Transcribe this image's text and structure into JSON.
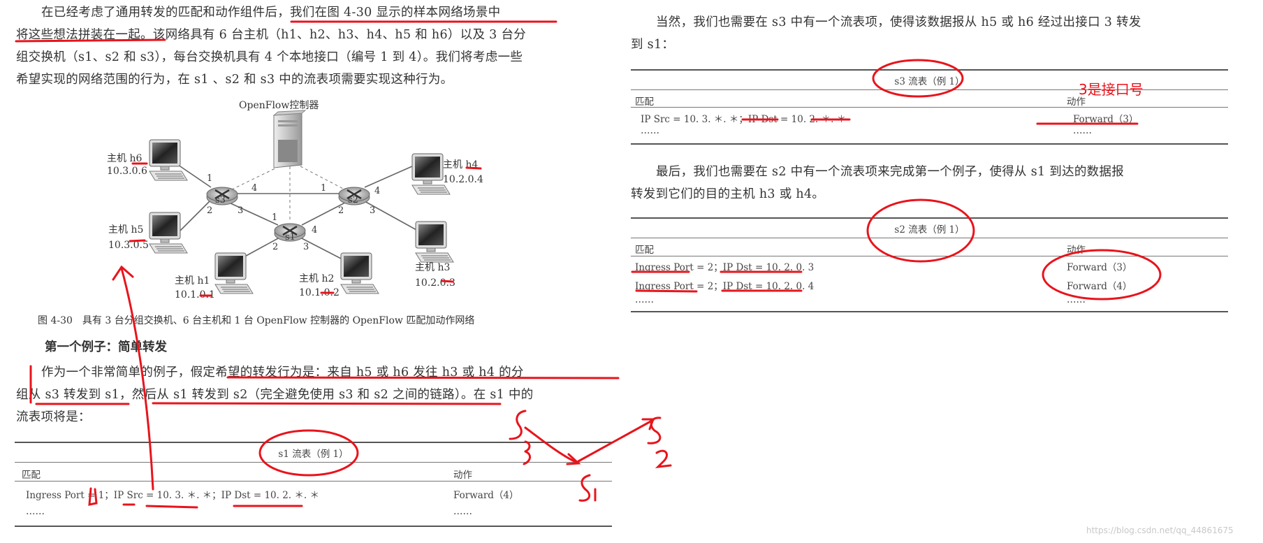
{
  "left": {
    "paragraph1": [
      "在已经考虑了通用转发的匹配和动作组件后，我们在图 4-30 显示的样本网络场景中",
      "将这些想法拼装在一起。该网络具有 6 台主机（h1、h2、h3、h4、h5 和 h6）以及 3 台分",
      "组交换机（s1、s2 和 s3），每台交换机具有 4 个本地接口（编号 1 到 4）。我们将考虑一些",
      "希望实现的网络范围的行为，在 s1 、s2 和 s3 中的流表项需要实现这种行为。"
    ],
    "figure": {
      "controller_label": "OpenFlow控制器",
      "switches": [
        "s1",
        "s2",
        "s3"
      ],
      "hosts": [
        {
          "label": "主机 h1",
          "ip": "10.1.0.1"
        },
        {
          "label": "主机 h2",
          "ip": "10.1.0.2"
        },
        {
          "label": "主机 h3",
          "ip": "10.2.0.3"
        },
        {
          "label": "主机 h4",
          "ip": "10.2.0.4"
        },
        {
          "label": "主机 h5",
          "ip": "10.3.0.5"
        },
        {
          "label": "主机 h6",
          "ip": "10.3.0.6"
        }
      ],
      "ports": {
        "p1": "1",
        "p2": "2",
        "p3": "3",
        "p4": "4"
      },
      "caption": "图 4-30　具有 3 台分组交换机、6 台主机和 1 台 OpenFlow 控制器的 OpenFlow 匹配加动作网络"
    },
    "heading": "第一个例子：简单转发",
    "paragraph2": [
      "作为一个非常简单的例子，假定希望的转发行为是：来自 h5 或 h6 发往 h3 或 h4 的分",
      "组从 s3 转发到 s1，然后从 s1 转发到 s2（完全避免使用 s3 和 s2 之间的链路）。在 s1 中的",
      "流表项将是："
    ],
    "s1_table": {
      "caption": "s1 流表（例 1）",
      "headers": [
        "匹配",
        "动作"
      ],
      "rows": [
        [
          "Ingress Port = 1；IP Src = 10. 3. ＊. ＊；IP Dst = 10. 2. ＊. ＊",
          "Forward（4）"
        ],
        [
          "……",
          "……"
        ]
      ]
    }
  },
  "right": {
    "paragraph1": [
      "当然，我们也需要在 s3 中有一个流表项，使得该数据报从 h5 或 h6 经过出接口 3 转发",
      "到 s1："
    ],
    "s3_table": {
      "caption": "s3 流表（例 1）",
      "headers": [
        "匹配",
        "动作"
      ],
      "rows": [
        [
          "IP Src = 10. 3. ＊. ＊；IP Dst = 10. 2. ＊. ＊",
          "Forward（3）"
        ],
        [
          "……",
          "……"
        ]
      ]
    },
    "paragraph2": [
      "最后，我们也需要在 s2 中有一个流表项来完成第一个例子，使得从 s1 到达的数据报",
      "转发到它们的目的主机 h3 或 h4。"
    ],
    "s2_table": {
      "caption": "s2 流表（例 1）",
      "headers": [
        "匹配",
        "动作"
      ],
      "rows": [
        [
          "Ingress Port = 2；IP Dst = 10. 2. 0. 3",
          "Forward（3）"
        ],
        [
          "Ingress Port = 2；IP Dst = 10. 2. 0. 4",
          "Forward（4）"
        ],
        [
          "……",
          "……"
        ]
      ]
    }
  },
  "annotations": {
    "note": "3是接口号",
    "color": "#e8141c"
  },
  "watermark": "https://blog.csdn.net/qq_44861675"
}
